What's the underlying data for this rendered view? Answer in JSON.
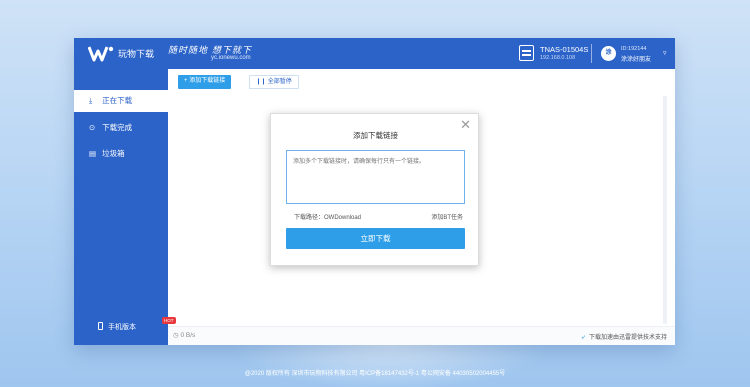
{
  "header": {
    "app_title": "玩物下载",
    "slogan": "随时随地 想下就下",
    "slogan_url": "yc.ionewu.com",
    "nas_name": "TNAS-01504S",
    "nas_ip": "192.168.0.108",
    "user_id": "ID:192144",
    "user_name": "涂涂好朋友",
    "avatar_text": "涂",
    "menu_icon": "▿"
  },
  "toolbar": {
    "add_label": "添加下载链接",
    "add_icon": "+",
    "pause_label": "全部暂停",
    "pause_icon": "❙❙"
  },
  "sidebar": {
    "items": [
      {
        "label": "正在下载",
        "icon": "⤓"
      },
      {
        "label": "下载完成",
        "icon": "⊙"
      },
      {
        "label": "垃圾箱",
        "icon": "▤"
      }
    ],
    "mobile_label": "手机版本",
    "hot_badge": "HOT"
  },
  "status": {
    "speed": "0 B/s",
    "support": "下载加速由迅雷提供技术支持"
  },
  "dialog": {
    "title": "添加下载链接",
    "close_icon": "✕",
    "placeholder": "添加多个下载链接时，请确保每行只有一个链接。",
    "path_label": "下载路径：OWDownload",
    "bt_label": "添加BT任务",
    "submit_label": "立即下载"
  },
  "footer": {
    "text": "@2020 版权所有 深圳市玩物科技有限公司 粤ICP备18147432号-1  粤公网安备 44030502004455号"
  },
  "colors": {
    "brand": "#2b63c9",
    "accent": "#2e9ee8",
    "hot": "#e8383d"
  }
}
